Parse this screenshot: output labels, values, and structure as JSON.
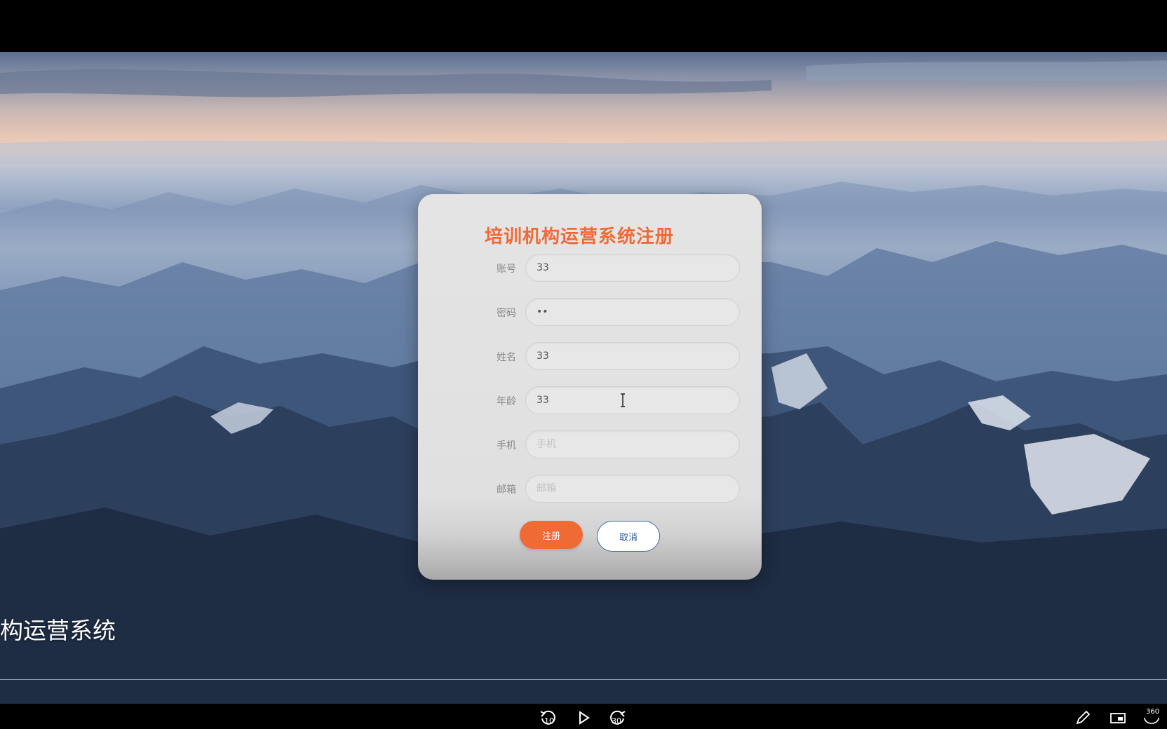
{
  "form": {
    "title": "培训机构运营系统注册",
    "fields": [
      {
        "label": "账号",
        "value": "33",
        "placeholder": "",
        "type": "text"
      },
      {
        "label": "密码",
        "value": "33",
        "placeholder": "",
        "type": "password"
      },
      {
        "label": "姓名",
        "value": "33",
        "placeholder": "",
        "type": "text"
      },
      {
        "label": "年龄",
        "value": "33",
        "placeholder": "",
        "type": "text"
      },
      {
        "label": "手机",
        "value": "",
        "placeholder": "手机",
        "type": "text"
      },
      {
        "label": "邮箱",
        "value": "",
        "placeholder": "邮箱",
        "type": "text"
      }
    ],
    "register_label": "注册",
    "cancel_label": "取消"
  },
  "background": {
    "caption": "构运营系统"
  },
  "player": {
    "rewind_seconds": "10",
    "forward_seconds": "30",
    "fullscreen_label": "360"
  },
  "colors": {
    "accent": "#f06a36",
    "cancel_border": "#3f6aa3",
    "card_bg": "#e4e4e4"
  },
  "icons": [
    "rewind-10-icon",
    "play-icon",
    "forward-30-icon",
    "pen-icon",
    "window-icon",
    "fullscreen-360-icon",
    "text-cursor-icon"
  ]
}
